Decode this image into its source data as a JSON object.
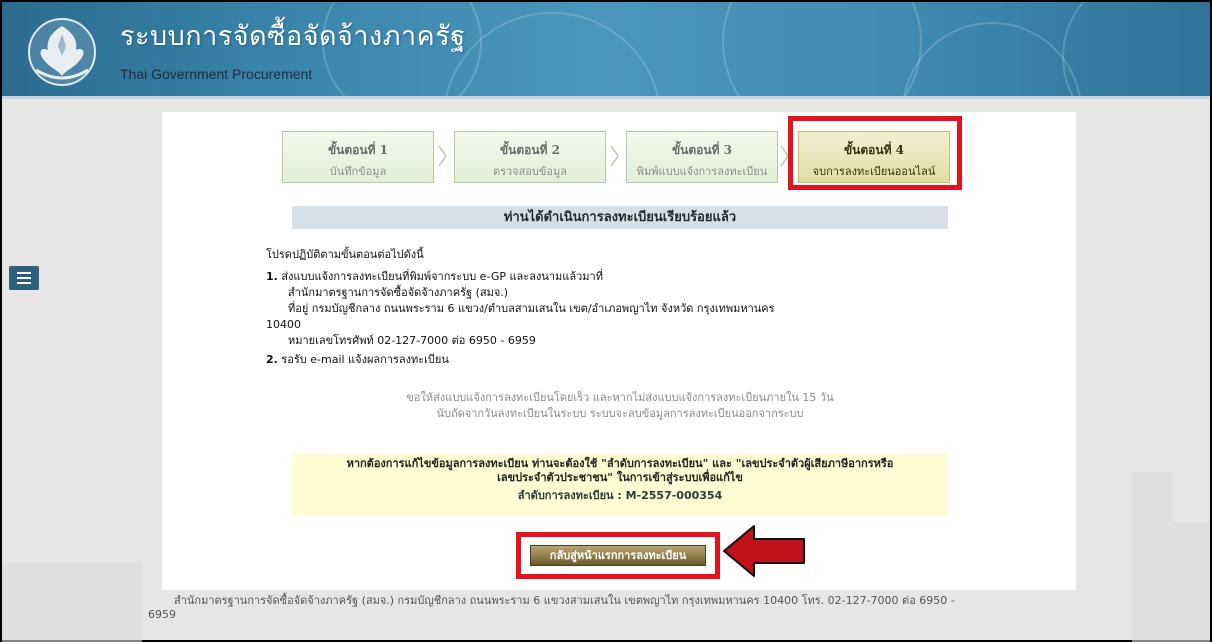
{
  "header": {
    "title_th": "ระบบการจัดซื้อจัดจ้างภาครัฐ",
    "title_en": "Thai Government Procurement",
    "emblem": "department-emblem-icon"
  },
  "menu": {
    "icon": "hamburger-menu-icon"
  },
  "steps": [
    {
      "number": "ขั้นตอนที่ 1",
      "label": "บันทึกข้อมูล",
      "active": false
    },
    {
      "number": "ขั้นตอนที่ 2",
      "label": "ตรวจสอบข้อมูล",
      "active": false
    },
    {
      "number": "ขั้นตอนที่ 3",
      "label": "พิมพ์แบบแจ้งการลงทะเบียน",
      "active": false
    },
    {
      "number": "ขั้นตอนที่ 4",
      "label": "จบการลงทะเบียนออนไลน์",
      "active": true
    }
  ],
  "banner": "ท่านได้ดำเนินการลงทะเบียนเรียบร้อยแล้ว",
  "instructions": {
    "intro": "โปรดปฏิบัติตามขั้นตอนต่อไปดังนี้",
    "item1_num": "1.",
    "item1": "ส่งแบบแจ้งการลงทะเบียนที่พิมพ์จากระบบ e-GP และลงนามแล้วมาที่",
    "item1_org": "สำนักมาตรฐานการจัดซื้อจัดจ้างภาครัฐ (สมจ.)",
    "item1_addr": "ที่อยู่ กรมบัญชีกลาง ถนนพระราม 6 แขวง/ตำบลสามเสนใน เขต/อำเภอพญาไท จังหวัด กรุงเทพมหานคร",
    "item1_zip": "10400",
    "item1_phone": "หมายเลขโทรศัพท์ 02-127-7000 ต่อ 6950 - 6959",
    "item2_num": "2.",
    "item2": "รอรับ e-mail แจ้งผลการลงทะเบียน"
  },
  "note": {
    "line1": "ขอให้ส่งแบบแจ้งการลงทะเบียนโดยเร็ว และหากไม่ส่งแบบแจ้งการลงทะเบียนภายใน 15 วัน",
    "line2": "นับถัดจากวันลงทะเบียนในระบบ ระบบจะลบข้อมูลการลงทะเบียนออกจากระบบ"
  },
  "edit_notice": {
    "line1": "หากต้องการแก้ไขข้อมูลการลงทะเบียน ท่านจะต้องใช้ \"ลำดับการลงทะเบียน\" และ \"เลขประจำตัวผู้เสียภาษีอากรหรือ",
    "line2": "เลขประจำตัวประชาชน\" ในการเข้าสู่ระบบเพื่อแก้ไข",
    "reg_label": "ลำดับการลงทะเบียน :",
    "reg_value": "M-2557-000354"
  },
  "back_button": "กลับสู่หน้าแรกการลงทะเบียน",
  "footer": "สำนักมาตรฐานการจัดซื้อจัดจ้างภาครัฐ (สมจ.) กรมบัญชีกลาง ถนนพระราม 6 แขวงสามเสนใน เขตพญาไท กรุงเทพมหานคร 10400 โทร. 02-127-7000 ต่อ 6950 - 6959",
  "colors": {
    "highlight": "#e3121c",
    "arrow": "#c1121a"
  }
}
